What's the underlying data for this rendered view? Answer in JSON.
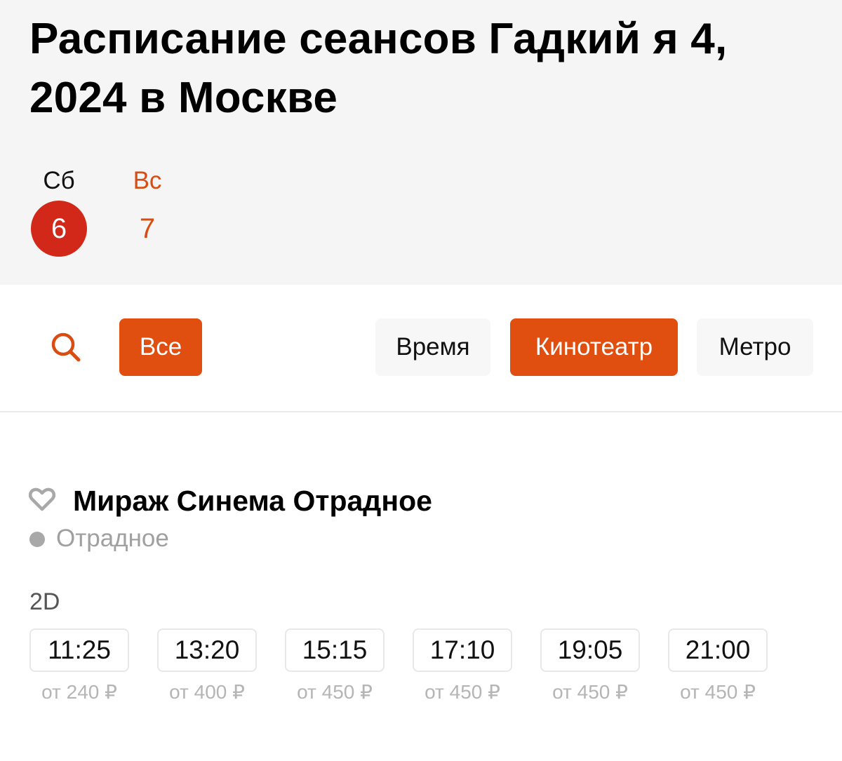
{
  "page": {
    "title": "Расписание сеансов Гадкий я 4, 2024 в Москве"
  },
  "dates": [
    {
      "day": "Сб",
      "num": "6",
      "active": true
    },
    {
      "day": "Вс",
      "num": "7",
      "active": false
    }
  ],
  "filters": {
    "search_icon": "search-icon",
    "all_label": "Все",
    "time_label": "Время",
    "cinema_label": "Кинотеатр",
    "metro_label": "Метро"
  },
  "cinema": {
    "favorite_icon": "heart-icon",
    "name": "Мираж Синема Отрадное",
    "metro": "Отрадное",
    "format": "2D",
    "sessions": [
      {
        "time": "11:25",
        "price": "от 240 ₽"
      },
      {
        "time": "13:20",
        "price": "от 400 ₽"
      },
      {
        "time": "15:15",
        "price": "от 450 ₽"
      },
      {
        "time": "17:10",
        "price": "от 450 ₽"
      },
      {
        "time": "19:05",
        "price": "от 450 ₽"
      },
      {
        "time": "21:00",
        "price": "от 450 ₽"
      }
    ]
  },
  "colors": {
    "accent": "#e04e10",
    "active_date": "#d1281a",
    "weekend": "#d94d12",
    "header_bg": "#f5f5f5",
    "muted": "#a0a0a0"
  }
}
